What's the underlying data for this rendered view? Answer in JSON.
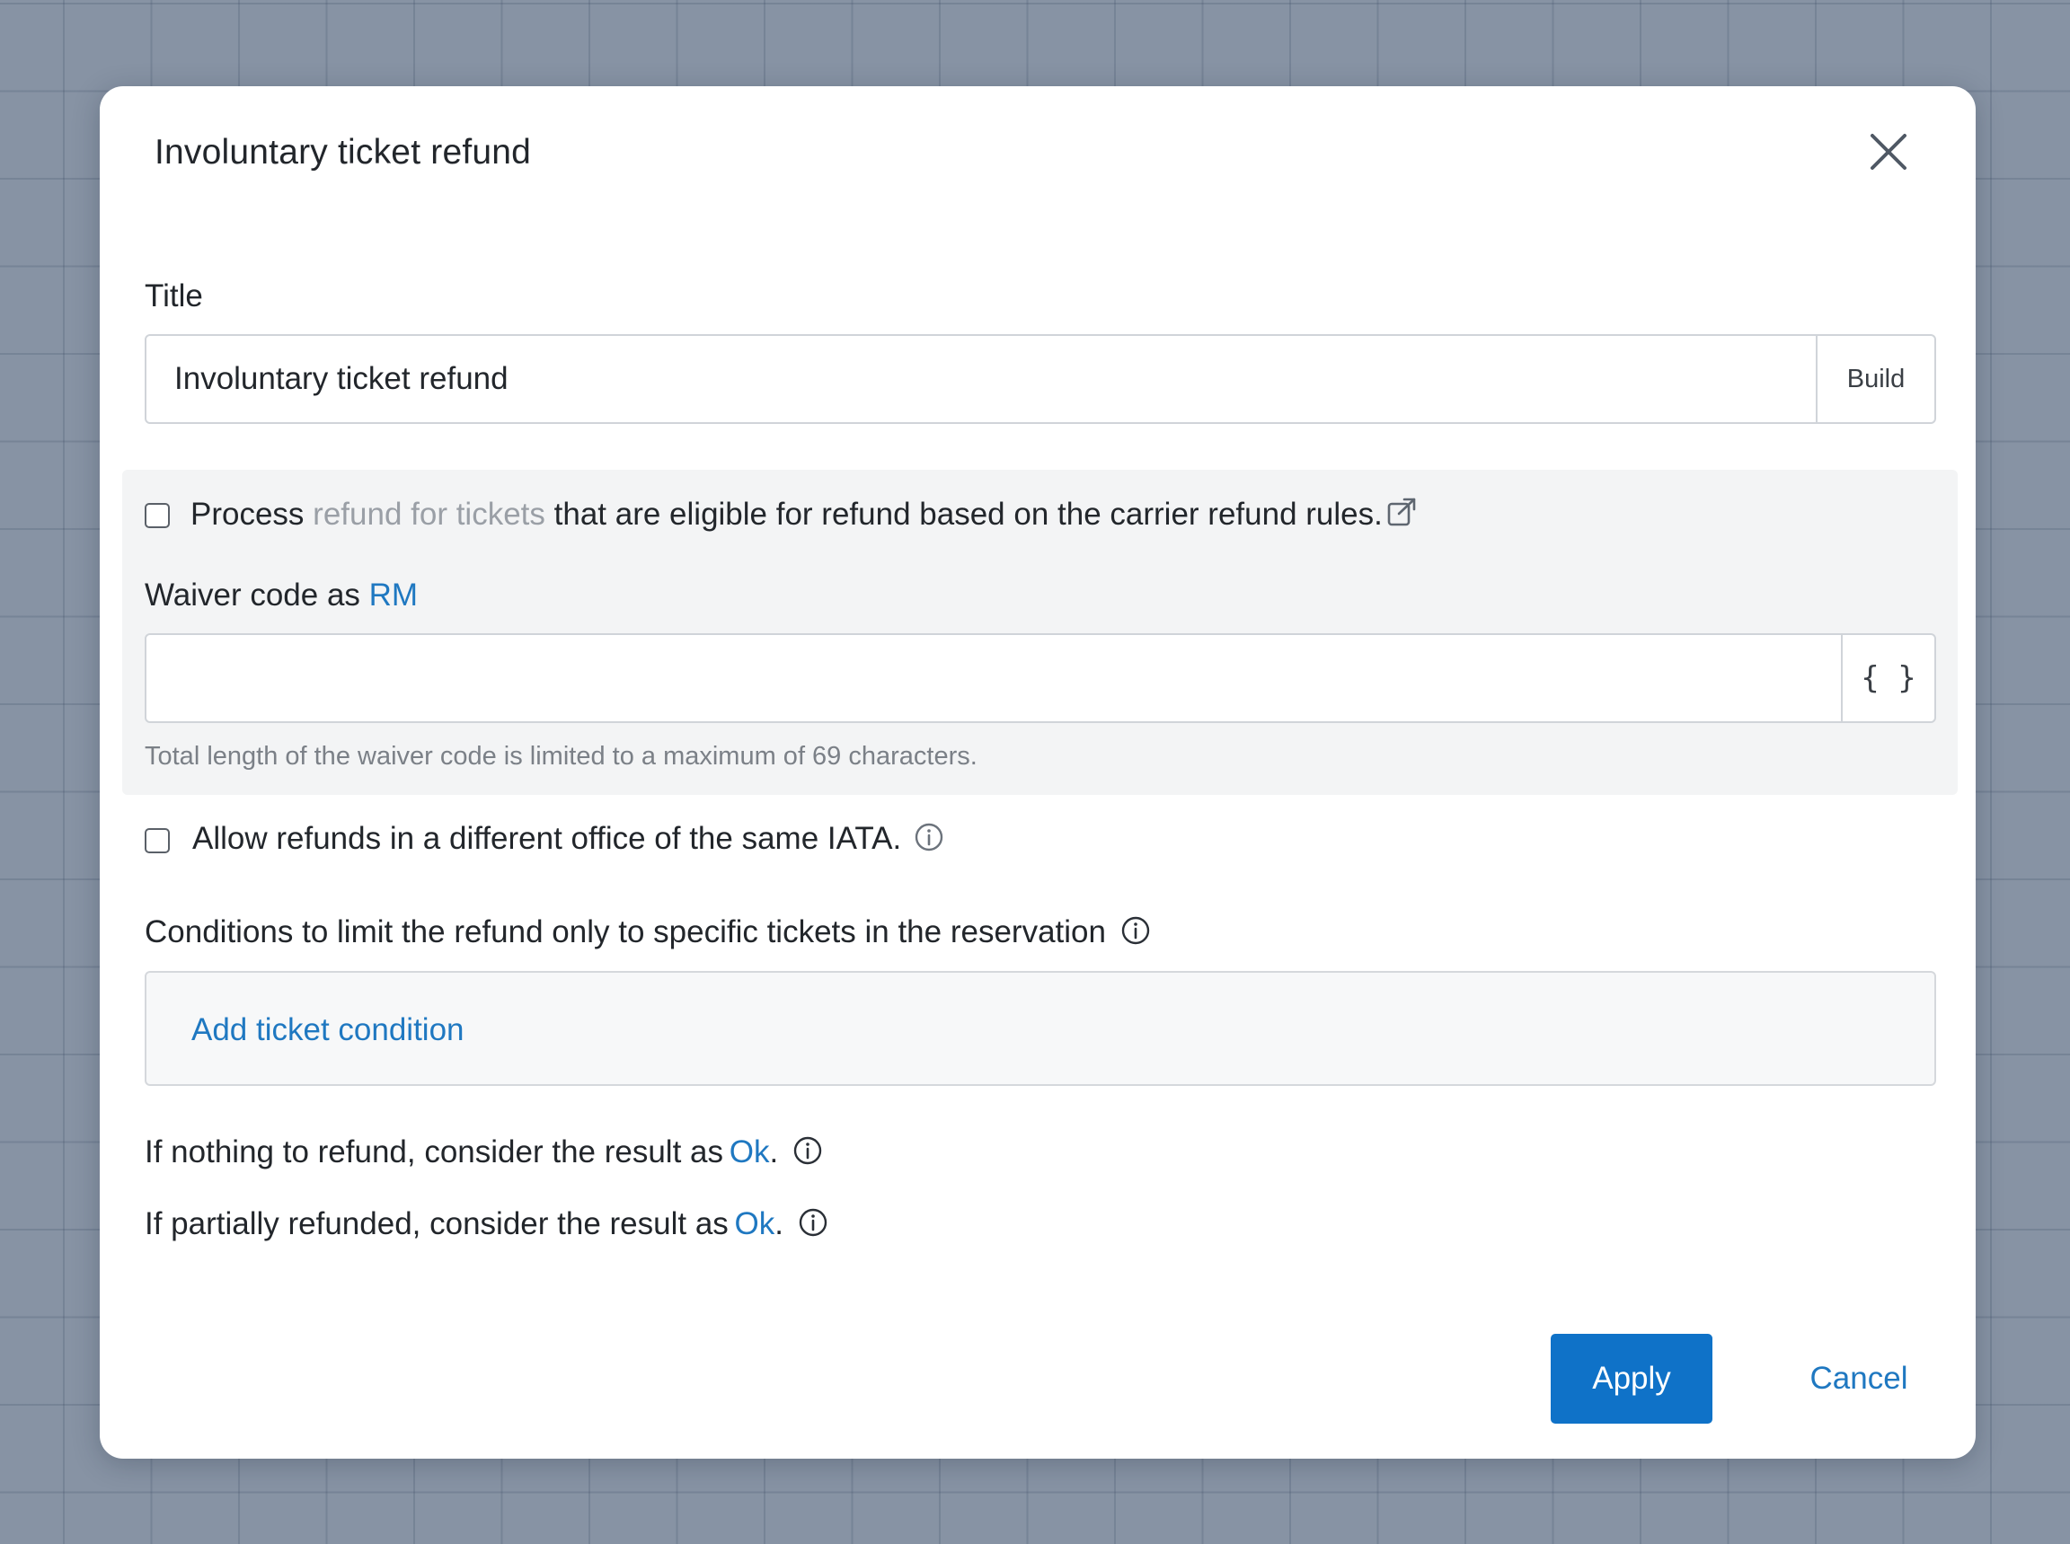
{
  "dialog": {
    "title": "Involuntary ticket refund",
    "close_icon": "close-icon"
  },
  "title_field": {
    "label": "Title",
    "value": "Involuntary ticket refund",
    "build_label": "Build"
  },
  "process_refund": {
    "checked": false,
    "text_before": "Process",
    "muted_text": "refund for tickets",
    "text_after": "that are eligible for refund based on the carrier refund rules.",
    "link_icon": "external-link-icon"
  },
  "waiver": {
    "label_prefix": "Waiver code as",
    "label_link": "RM",
    "value": "",
    "addon_label": "{ }",
    "hint": "Total length of the waiver code is limited to a maximum of 69 characters."
  },
  "allow_refunds": {
    "checked": false,
    "text": "Allow refunds in a different office of the same IATA.",
    "icon": "info-icon"
  },
  "conditions": {
    "label": "Conditions to limit the refund only to specific tickets in the reservation",
    "add_link": "Add ticket condition"
  },
  "nothing_to_refund": {
    "text": "If nothing to refund, consider the result as",
    "value": "Ok",
    "suffix": "."
  },
  "partially_refunded": {
    "text": "If partially refunded, consider the result as",
    "value": "Ok",
    "suffix": "."
  },
  "footer": {
    "apply_label": "Apply",
    "cancel_label": "Cancel"
  },
  "colors": {
    "primary": "#0f72c8",
    "link": "#1f78c1",
    "backdrop": "#8793a4",
    "panel": "#f3f4f5"
  }
}
